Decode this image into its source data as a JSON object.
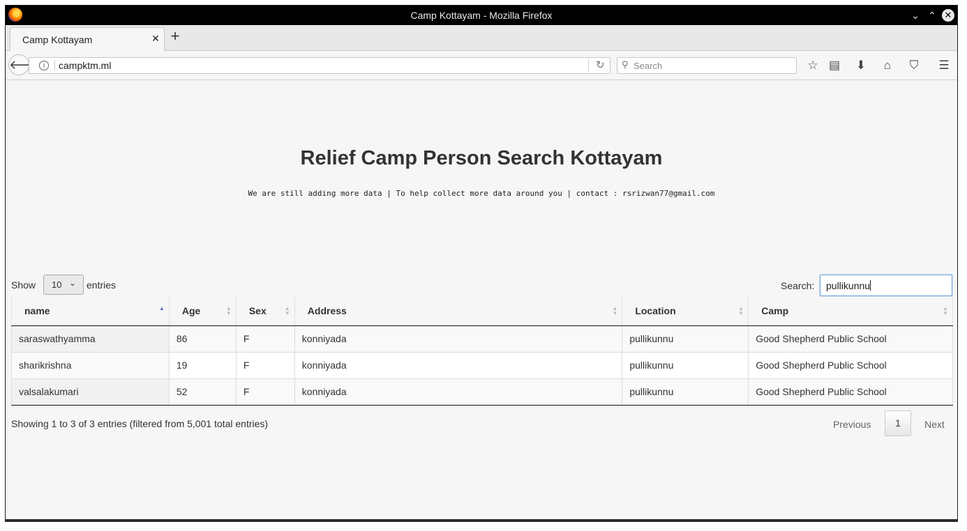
{
  "window": {
    "title": "Camp Kottayam - Mozilla Firefox",
    "controls": {
      "minimize": "⌄",
      "maximize": "⌃",
      "close": "✕"
    }
  },
  "tabs": [
    {
      "label": "Camp Kottayam",
      "close": "✕"
    }
  ],
  "newtab": "+",
  "navbar": {
    "url": "campktm.ml",
    "search_placeholder": "Search"
  },
  "page": {
    "title": "Relief Camp Person Search Kottayam",
    "subtitle": "We are still adding more data | To help collect more data around you | contact : rsrizwan77@gmail.com"
  },
  "controls": {
    "show_label": "Show",
    "entries_label": "entries",
    "page_length": "10",
    "search_label": "Search:",
    "search_value": "pullikunnu"
  },
  "table": {
    "columns": [
      "name",
      "Age",
      "Sex",
      "Address",
      "Location",
      "Camp"
    ],
    "sorted_column": "name",
    "sort_direction": "ascending",
    "rows": [
      [
        "saraswathyamma",
        "86",
        "F",
        "konniyada",
        "pullikunnu",
        "Good Shepherd Public School"
      ],
      [
        "sharikrishna",
        "19",
        "F",
        "konniyada",
        "pullikunnu",
        "Good Shepherd Public School"
      ],
      [
        "valsalakumari",
        "52",
        "F",
        "konniyada",
        "pullikunnu",
        "Good Shepherd Public School"
      ]
    ]
  },
  "footer": {
    "info": "Showing 1 to 3 of 3 entries (filtered from 5,001 total entries)",
    "previous": "Previous",
    "current_page": "1",
    "next": "Next"
  },
  "colors": {
    "titlebar": "#000000",
    "page_background": "#f6f6f6",
    "sort_active": "#5b6bbf",
    "search_focus": "#6da1d6"
  }
}
